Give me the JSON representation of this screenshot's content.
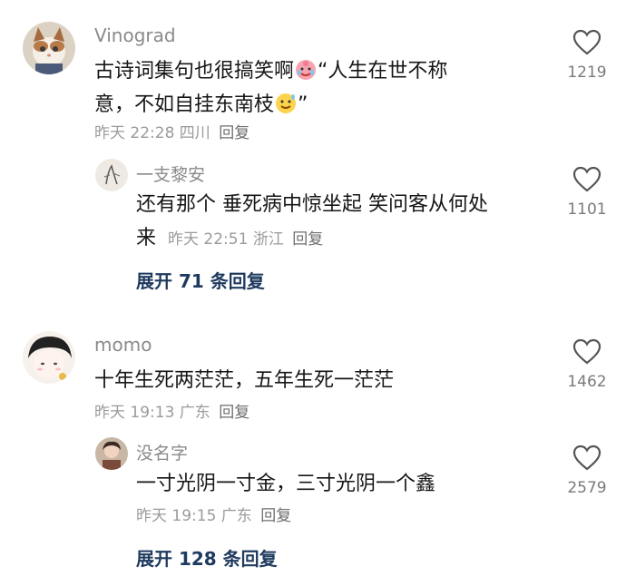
{
  "comments": [
    {
      "username": "Vinograd",
      "text_line1_a": "古诗词集句也很搞笑啊",
      "text_line1_b": "“人生在世不称",
      "text_line2_a": "意，不如自挂东南枝",
      "text_line2_b": "”",
      "meta_time": "昨天 22:28 四川",
      "meta_reply": "回复",
      "likes": "1219",
      "replies": [
        {
          "username": "一支黎安",
          "text_line1": "还有那个 垂死病中惊坐起 笑问客从何处",
          "text_line2_a": "来",
          "meta_time": "昨天 22:51 浙江",
          "meta_reply": "回复",
          "likes": "1101"
        }
      ],
      "expand_label": "展开 71 条回复"
    },
    {
      "username": "momo",
      "text_line1": "十年生死两茫茫，五年生死一茫茫",
      "meta_time": "昨天 19:13 广东",
      "meta_reply": "回复",
      "likes": "1462",
      "replies": [
        {
          "username": "没名字",
          "text_line1": "一寸光阴一寸金，三寸光阴一个鑫",
          "meta_time": "昨天 19:15 广东",
          "meta_reply": "回复",
          "likes": "2579"
        }
      ],
      "expand_label": "展开 128 条回复"
    }
  ]
}
